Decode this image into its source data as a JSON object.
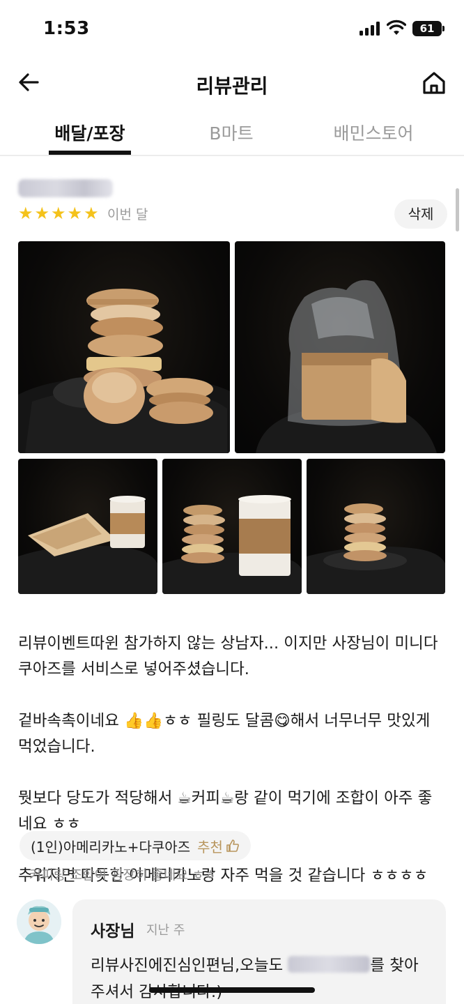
{
  "status_bar": {
    "time": "1:53",
    "battery": "61"
  },
  "header": {
    "title": "리뷰관리",
    "back_icon": "arrow-left-icon",
    "home_icon": "home-icon"
  },
  "tabs": [
    {
      "label": "배달/포장",
      "active": true
    },
    {
      "label": "B마트",
      "active": false
    },
    {
      "label": "배민스토어",
      "active": false
    }
  ],
  "review": {
    "rating": 5,
    "stars": [
      "★",
      "★",
      "★",
      "★",
      "★"
    ],
    "date": "이번 달",
    "delete_label": "삭제",
    "photo_count": 5,
    "text_lines": [
      "리뷰이벤트따윈 참가하지 않는 상남자... 이지만 사장님이 미니다쿠아즈를 서비스로 넣어주셨습니다.",
      "겉바속촉이네요 👍👍ㅎㅎ 필링도 달콤😋해서 너무너무 맛있게 먹었습니다.",
      "뭣보다 당도가 적당해서 ☕커피☕랑 같이 먹기에 조합이 아주 좋네요 ㅎㅎ",
      "추워지면 따듯한 아메리카노랑 자주 먹을 것 같습니다 ㅎㅎㅎㅎ"
    ],
    "menu_item": "(1인)아메리카노+다쿠아즈",
    "recommend_label": "추천",
    "menu_comment": "커피랑 조합이 굉장히 좋네요 ㅎㅎ"
  },
  "owner_reply": {
    "name": "사장님",
    "date": "지난 주",
    "text_before": "리뷰사진에진심인편님,오늘도 ",
    "text_after": "를 찾아주셔서 감사합니다:)"
  },
  "colors": {
    "star": "#f4c21b",
    "recommend": "#b8955c",
    "chip_bg": "#f4f4f4"
  }
}
